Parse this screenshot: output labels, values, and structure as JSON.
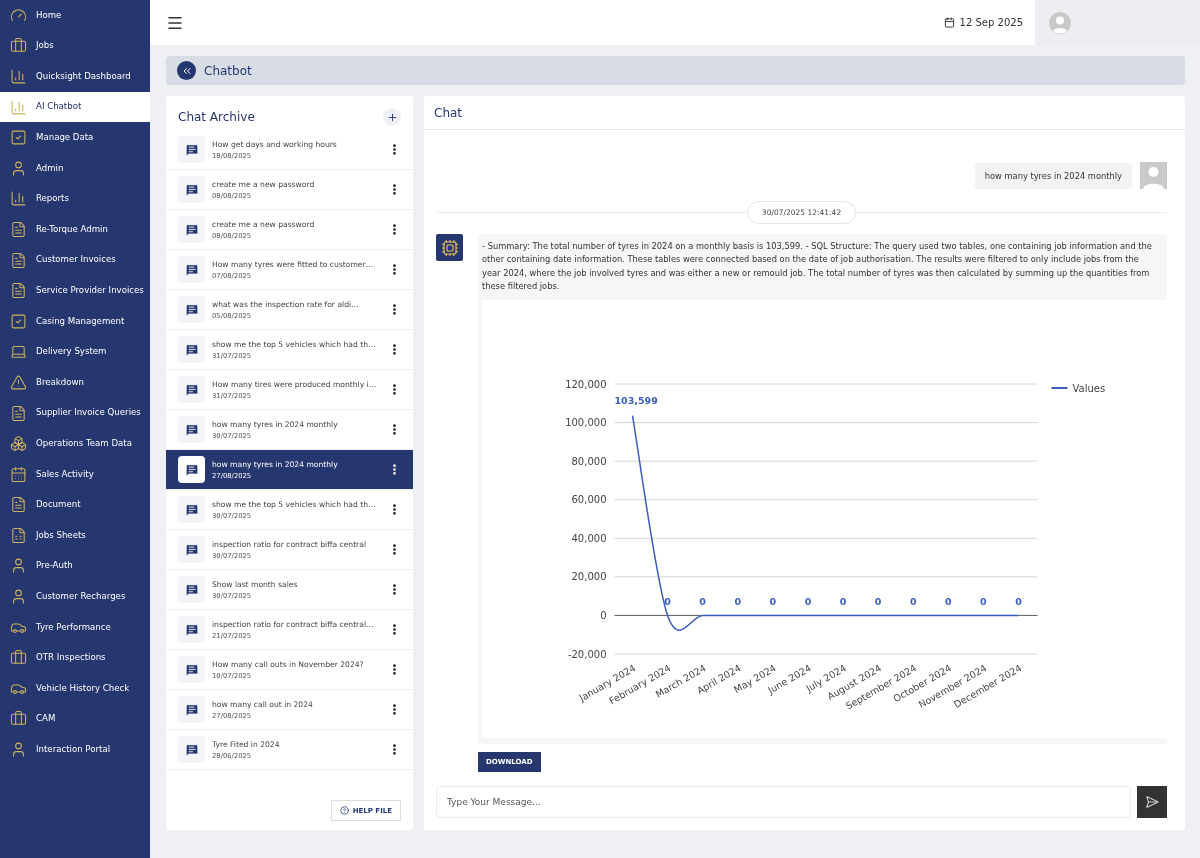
{
  "sidebar": {
    "items": [
      {
        "label": "Home",
        "kind": "gauge",
        "selected": false
      },
      {
        "label": "Jobs",
        "kind": "briefcase",
        "selected": false
      },
      {
        "label": "Quicksight Dashboard",
        "kind": "chart",
        "selected": false
      },
      {
        "label": "AI Chatbot",
        "kind": "chart",
        "selected": true
      },
      {
        "label": "Manage Data",
        "kind": "check",
        "selected": false
      },
      {
        "label": "Admin",
        "kind": "user",
        "selected": false
      },
      {
        "label": "Reports",
        "kind": "chart",
        "selected": false
      },
      {
        "label": "Re-Torque Admin",
        "kind": "file",
        "selected": false
      },
      {
        "label": "Customer Invoices",
        "kind": "file",
        "selected": false
      },
      {
        "label": "Service Provider Invoices",
        "kind": "file",
        "selected": false
      },
      {
        "label": "Casing Management",
        "kind": "check",
        "selected": false
      },
      {
        "label": "Delivery System",
        "kind": "laptop",
        "selected": false
      },
      {
        "label": "Breakdown",
        "kind": "warning",
        "selected": false
      },
      {
        "label": "Supplier Invoice Queries",
        "kind": "file",
        "selected": false
      },
      {
        "label": "Operations Team Data",
        "kind": "boxes",
        "selected": false
      },
      {
        "label": "Sales Activity",
        "kind": "calendar",
        "selected": false
      },
      {
        "label": "Document",
        "kind": "file",
        "selected": false
      },
      {
        "label": "Jobs Sheets",
        "kind": "sheet",
        "selected": false
      },
      {
        "label": "Pre-Auth",
        "kind": "user",
        "selected": false
      },
      {
        "label": "Customer Recharges",
        "kind": "user",
        "selected": false
      },
      {
        "label": "Tyre Performance",
        "kind": "car",
        "selected": false
      },
      {
        "label": "OTR Inspections",
        "kind": "briefcase",
        "selected": false
      },
      {
        "label": "Vehicle History Check",
        "kind": "car",
        "selected": false
      },
      {
        "label": "CAM",
        "kind": "briefcase",
        "selected": false
      },
      {
        "label": "Interaction Portal",
        "kind": "user",
        "selected": false
      }
    ]
  },
  "topbar": {
    "date": "12 Sep 2025"
  },
  "breadcrumb": {
    "title": "Chatbot"
  },
  "archive": {
    "title": "Chat Archive",
    "items": [
      {
        "title": "How get days and working hours",
        "date": "18/08/2025",
        "selected": false
      },
      {
        "title": "create me a new password",
        "date": "08/08/2025",
        "selected": false
      },
      {
        "title": "create me a new password",
        "date": "08/08/2025",
        "selected": false
      },
      {
        "title": "How many tyres were fitted to customer…",
        "date": "07/08/2025",
        "selected": false
      },
      {
        "title": "what was the inspection rate for aldi…",
        "date": "05/08/2025",
        "selected": false
      },
      {
        "title": "show me the top 5 vehicles which had th…",
        "date": "31/07/2025",
        "selected": false
      },
      {
        "title": "How many tires were produced monthly i…",
        "date": "31/07/2025",
        "selected": false
      },
      {
        "title": "how many tyres in 2024 monthly",
        "date": "30/07/2025",
        "selected": false
      },
      {
        "title": "how many tyres in 2024 monthly",
        "date": "27/08/2025",
        "selected": true
      },
      {
        "title": "show me the top 5 vehicles which had th…",
        "date": "30/07/2025",
        "selected": false
      },
      {
        "title": "inspection ratio for contract biffa central",
        "date": "30/07/2025",
        "selected": false
      },
      {
        "title": "Show last month sales",
        "date": "30/07/2025",
        "selected": false
      },
      {
        "title": "inspection ratio for contract biffa central…",
        "date": "21/07/2025",
        "selected": false
      },
      {
        "title": "How many call outs in November 2024?",
        "date": "10/07/2025",
        "selected": false
      },
      {
        "title": "how many call out in 2024",
        "date": "27/08/2025",
        "selected": false
      },
      {
        "title": "Tyre Fited in 2024",
        "date": "28/06/2025",
        "selected": false
      }
    ],
    "help_button": "HELP FILE"
  },
  "chat": {
    "title": "Chat",
    "user_message": "how many tyres in 2024 monthly",
    "timestamp": "30/07/2025 12:41:42",
    "bot_message": "- Summary: The total number of tyres in 2024 on a monthly basis is 103,599. - SQL Structure: The query used two tables, one containing job information and the other containing date information. These tables were connected based on the date of job authorisation. The results were filtered to only include jobs from the year 2024, where the job involved tyres and was either a new or remould job. The total number of tyres was then calculated by summing up the quantities from these filtered jobs.",
    "chart_data": {
      "type": "line",
      "categories": [
        "January 2024",
        "February 2024",
        "March 2024",
        "April 2024",
        "May 2024",
        "June 2024",
        "July 2024",
        "August 2024",
        "September 2024",
        "October 2024",
        "November 2024",
        "December 2024"
      ],
      "series": [
        {
          "name": "Values",
          "color": "#3b5fc0",
          "values": [
            103599,
            0,
            0,
            0,
            0,
            0,
            0,
            0,
            0,
            0,
            0,
            0
          ]
        }
      ],
      "ylim": [
        -20000,
        120000
      ],
      "grid": true,
      "yticks": [
        {
          "value": -20000,
          "label": "-20,000"
        },
        {
          "value": 0,
          "label": "0"
        },
        {
          "value": 20000,
          "label": "20,000"
        },
        {
          "value": 40000,
          "label": "40,000"
        },
        {
          "value": 60000,
          "label": "60,000"
        },
        {
          "value": 80000,
          "label": "80,000"
        },
        {
          "value": 100000,
          "label": "100,000"
        },
        {
          "value": 120000,
          "label": "120,000"
        }
      ],
      "value_labels": [
        "103,599",
        "0",
        "0",
        "0",
        "0",
        "0",
        "0",
        "0",
        "0",
        "0",
        "0",
        "0"
      ]
    },
    "download_button": "DOWNLOAD",
    "input": {
      "placeholder": "Type Your Message..."
    }
  }
}
